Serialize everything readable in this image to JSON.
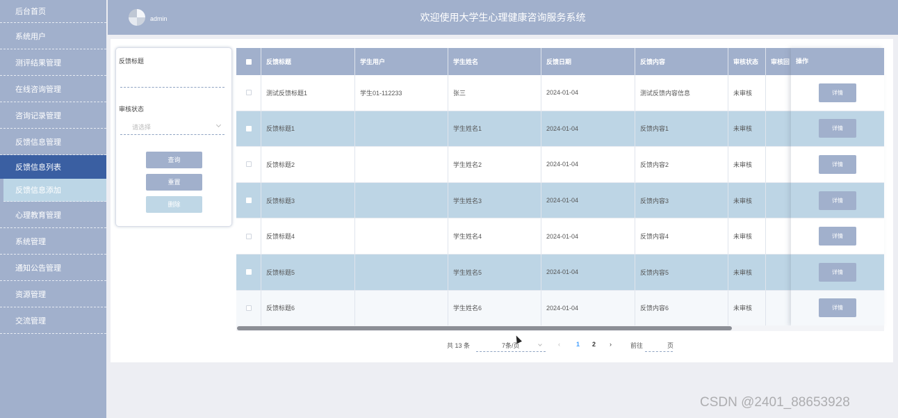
{
  "sidebar": {
    "items": [
      {
        "label": "后台首页"
      },
      {
        "label": "系统用户"
      },
      {
        "label": "测评结果管理"
      },
      {
        "label": "在线咨询管理"
      },
      {
        "label": "咨询记录管理"
      },
      {
        "label": "反馈信息管理"
      },
      {
        "label": "反馈信息列表"
      },
      {
        "label": "反馈信息添加"
      },
      {
        "label": "心理教育管理"
      },
      {
        "label": "系统管理"
      },
      {
        "label": "通知公告管理"
      },
      {
        "label": "资源管理"
      },
      {
        "label": "交流管理"
      }
    ]
  },
  "header": {
    "username": "admin",
    "title": "欢迎使用大学生心理健康咨询服务系统"
  },
  "search": {
    "title_label": "反馈标题",
    "title_value": "",
    "status_label": "审核状态",
    "status_placeholder": "请选择",
    "query_label": "查询",
    "reset_label": "重置",
    "delete_label": "删除"
  },
  "table": {
    "headers": [
      "反馈标题",
      "学生用户",
      "学生姓名",
      "反馈日期",
      "反馈内容",
      "审核状态",
      "审核回",
      "操作"
    ],
    "rows": [
      [
        "测试反馈标题1",
        "学生01-112233",
        "张三",
        "2024-01-04",
        "测试反馈内容信息",
        "未审核",
        ""
      ],
      [
        "反馈标题1",
        "",
        "学生姓名1",
        "2024-01-04",
        "反馈内容1",
        "未审核",
        ""
      ],
      [
        "反馈标题2",
        "",
        "学生姓名2",
        "2024-01-04",
        "反馈内容2",
        "未审核",
        ""
      ],
      [
        "反馈标题3",
        "",
        "学生姓名3",
        "2024-01-04",
        "反馈内容3",
        "未审核",
        ""
      ],
      [
        "反馈标题4",
        "",
        "学生姓名4",
        "2024-01-04",
        "反馈内容4",
        "未审核",
        ""
      ],
      [
        "反馈标题5",
        "",
        "学生姓名5",
        "2024-01-04",
        "反馈内容5",
        "未审核",
        ""
      ],
      [
        "反馈标题6",
        "",
        "学生姓名6",
        "2024-01-04",
        "反馈内容6",
        "未审核",
        ""
      ]
    ],
    "detail_label": "详情"
  },
  "pagination": {
    "total": "共 13 条",
    "page_size": "7条/页",
    "pages": [
      "1",
      "2"
    ],
    "current_page": "1",
    "goto_label": "前往",
    "goto_value": "",
    "page_unit": "页"
  },
  "watermark": "CSDN @2401_88653928",
  "colors": {
    "primary": "#a1b0cc",
    "active_nav": "#3a5fa2",
    "row_alt": "#bdd5e5",
    "page_active": "#409eff"
  }
}
